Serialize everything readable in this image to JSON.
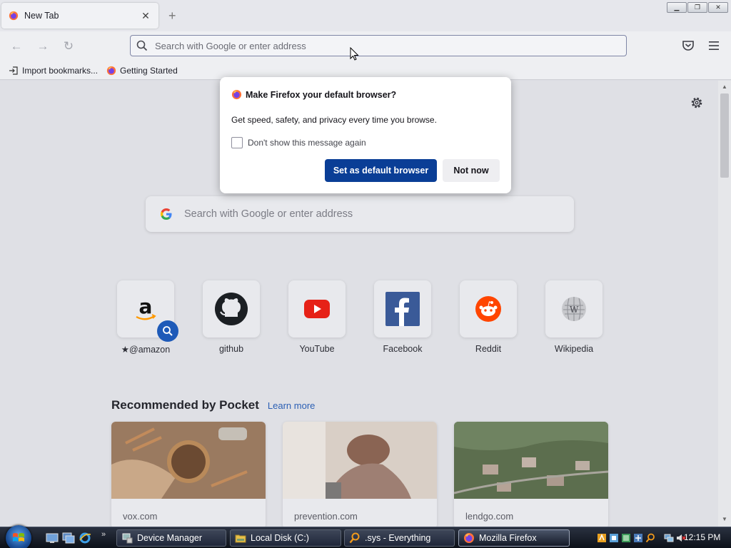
{
  "browser": {
    "tab_title": "New Tab",
    "tab_close": "✕",
    "new_tab": "+",
    "window_controls": [
      "minimize",
      "restore",
      "close"
    ],
    "url_placeholder": "Search with Google or enter address"
  },
  "bookmarks": [
    {
      "label": "Import bookmarks...",
      "icon": "import-icon"
    },
    {
      "label": "Getting Started",
      "icon": "firefox-icon"
    }
  ],
  "newtab": {
    "search_placeholder": "Search with Google or enter address",
    "top_sites": [
      {
        "label": "@amazon",
        "prefix": "★",
        "icon": "amazon-icon"
      },
      {
        "label": "github",
        "icon": "github-icon"
      },
      {
        "label": "YouTube",
        "icon": "youtube-icon"
      },
      {
        "label": "Facebook",
        "icon": "facebook-icon"
      },
      {
        "label": "Reddit",
        "icon": "reddit-icon"
      },
      {
        "label": "Wikipedia",
        "icon": "wikipedia-icon"
      }
    ],
    "pocket": {
      "heading": "Recommended by Pocket",
      "learn_more": "Learn more",
      "cards": [
        {
          "source": "vox.com"
        },
        {
          "source": "prevention.com"
        },
        {
          "source": "lendgo.com"
        }
      ]
    }
  },
  "dialog": {
    "title": "Make Firefox your default browser?",
    "body": "Get speed, safety, and privacy every time you browse.",
    "checkbox_label": "Don't show this message again",
    "checkbox_checked": false,
    "primary_button": "Set as default browser",
    "secondary_button": "Not now"
  },
  "taskbar": {
    "tasks": [
      {
        "label": "Device Manager",
        "icon": "device-manager-icon",
        "active": false
      },
      {
        "label": "Local Disk (C:)",
        "icon": "folder-icon",
        "active": false
      },
      {
        "label": ".sys - Everything",
        "icon": "everything-search-icon",
        "active": false
      },
      {
        "label": "Mozilla Firefox",
        "icon": "firefox-icon",
        "active": true
      }
    ],
    "quicklaunch_more": "»",
    "clock": "12:15 PM"
  },
  "colors": {
    "primary_button": "#0a3e96",
    "link": "#2b5fb4",
    "taskbar": "#1a1f2b"
  }
}
